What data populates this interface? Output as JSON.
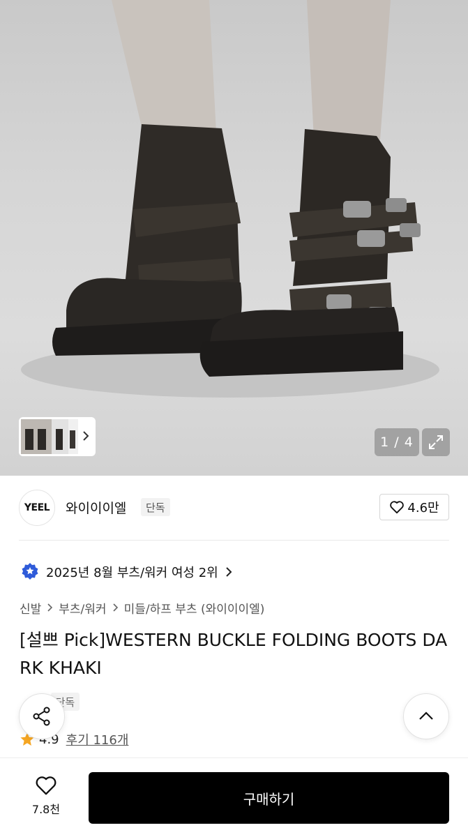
{
  "gallery": {
    "counter": "1 / 4"
  },
  "brand": {
    "logo_text": "YEEL",
    "name": "와이이이엘",
    "exclusive_badge": "단독",
    "likes": "4.6만"
  },
  "ranking": {
    "text": "2025년 8월 부츠/워커 여성 2위"
  },
  "breadcrumb": {
    "items": [
      "신발",
      "부츠/워커",
      "미들/하프 부츠 (와이이이엘)"
    ]
  },
  "product": {
    "title": "[설쁘 Pick]WESTERN BUCKLE FOLDING BOOTS DARK KHAKI",
    "badges": [
      "단독"
    ],
    "rating": "4.9",
    "reviews": "후기 116개"
  },
  "bottom_bar": {
    "wish_count": "7.8천",
    "buy_label": "구매하기"
  },
  "colors": {
    "accent_star": "#f5a623",
    "rank_badge": "#2f5bd9",
    "buy_button": "#000000"
  }
}
